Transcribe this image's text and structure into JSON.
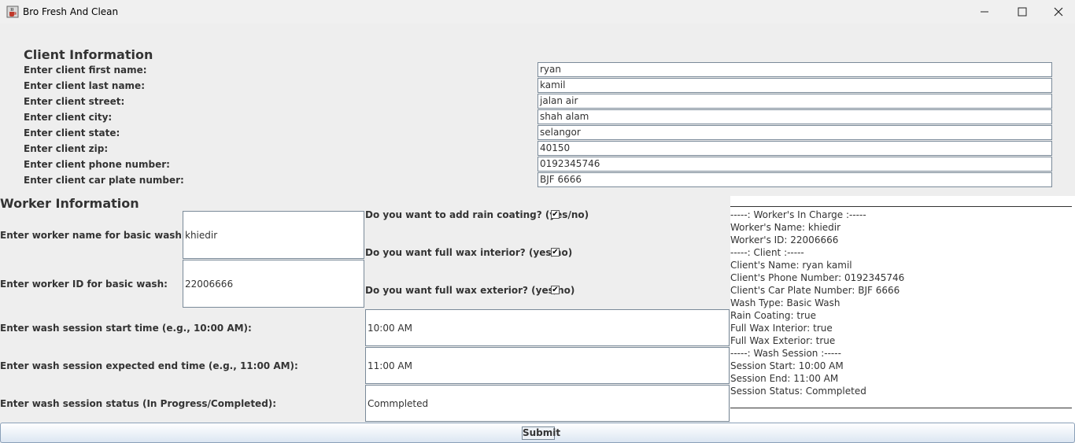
{
  "window": {
    "title": "Bro Fresh And Clean",
    "app_icon": "java-coffee-icon"
  },
  "client": {
    "heading": "Client Information",
    "fields": [
      {
        "label": "Enter client first name:",
        "value": "ryan"
      },
      {
        "label": "Enter client last name:",
        "value": "kamil"
      },
      {
        "label": "Enter client street:",
        "value": "jalan air"
      },
      {
        "label": "Enter client city:",
        "value": "shah alam"
      },
      {
        "label": "Enter client state:",
        "value": "selangor"
      },
      {
        "label": "Enter client zip:",
        "value": "40150"
      },
      {
        "label": "Enter client phone number:",
        "value": "0192345746"
      },
      {
        "label": "Enter client car plate number:",
        "value": "BJF 6666"
      }
    ]
  },
  "worker": {
    "heading": "Worker Information",
    "name_label": "Enter worker name for basic wash:",
    "name_value": "khiedir",
    "id_label": "Enter worker ID for basic wash:",
    "id_value": "22006666",
    "rain_label": "Do you want to add rain coating? (yes/no)",
    "rain_checked": true,
    "interior_label": "Do you want full wax interior? (yes/no)",
    "interior_checked": true,
    "exterior_label": "Do you want full wax exterior? (yes/no)",
    "exterior_checked": true,
    "check_mark": "✔"
  },
  "session": {
    "start_label": "Enter wash session start time (e.g., 10:00 AM):",
    "start_value": "10:00 AM",
    "end_label": "Enter wash session expected end time (e.g., 11:00 AM):",
    "end_value": "11:00 AM",
    "status_label": "Enter wash session status (In Progress/Completed):",
    "status_value": "Commpleted"
  },
  "summary": {
    "lines": [
      "-----: Worker's In Charge :-----",
      "Worker's Name: khiedir",
      "Worker's ID: 22006666",
      "-----: Client :-----",
      "Client's Name: ryan kamil",
      "Client's Phone Number: 0192345746",
      "Client's Car Plate Number: BJF 6666",
      "Wash Type: Basic Wash",
      "Rain Coating: true",
      "Full Wax Interior: true",
      "Full Wax Exterior: true",
      "-----: Wash Session :-----",
      "Session Start: 10:00 AM",
      "Session End: 11:00 AM",
      "Session Status: Commpleted"
    ]
  },
  "submit_label": "Submit"
}
